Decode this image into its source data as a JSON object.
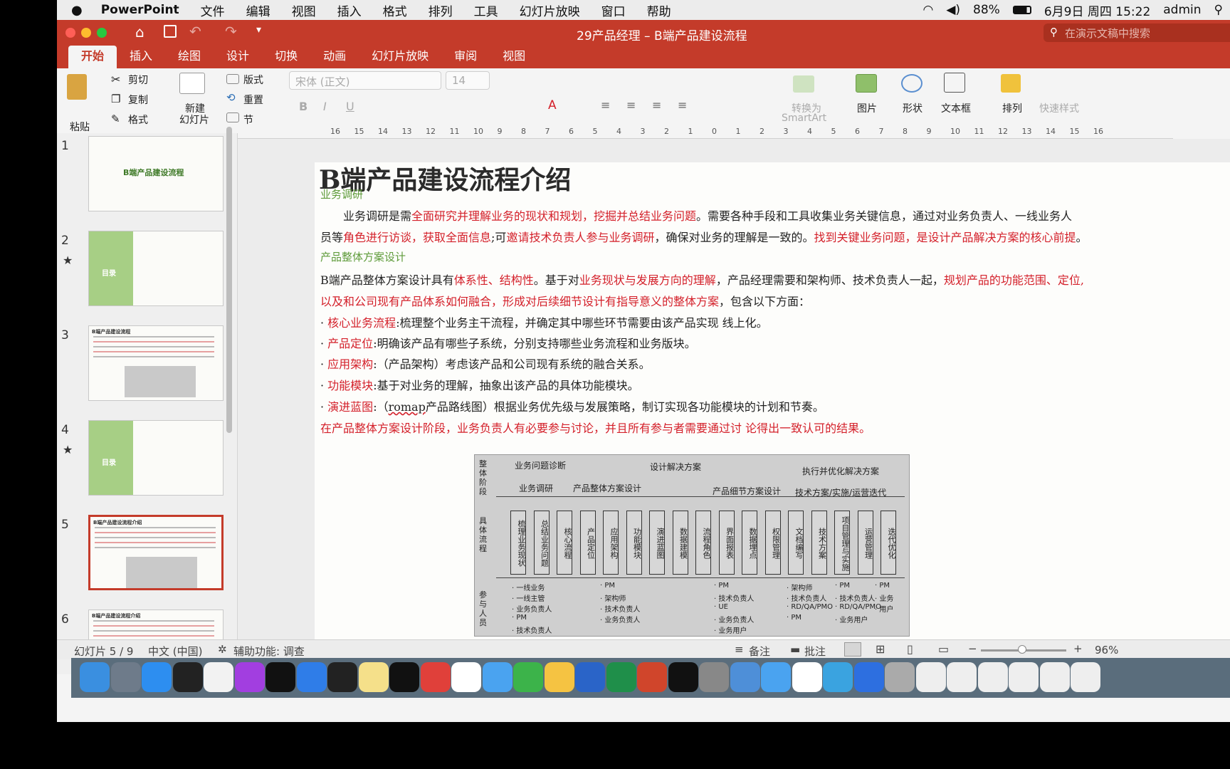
{
  "menubar": {
    "app_name": "PowerPoint",
    "items": [
      "文件",
      "编辑",
      "视图",
      "插入",
      "格式",
      "排列",
      "工具",
      "幻灯片放映",
      "窗口",
      "帮助"
    ],
    "battery": "88%",
    "datetime": "6月9日 周四 15:22",
    "user": "admin"
  },
  "window": {
    "title": "29产品经理 – B端产品建设流程",
    "search_placeholder": "在演示文稿中搜索"
  },
  "tabs": [
    "开始",
    "插入",
    "绘图",
    "设计",
    "切换",
    "动画",
    "幻灯片放映",
    "审阅",
    "视图"
  ],
  "ribbon": {
    "paste": "粘贴",
    "cut": "剪切",
    "copy": "复制",
    "format": "格式",
    "new_slide_line1": "新建",
    "new_slide_line2": "幻灯片",
    "layout": "版式",
    "reset": "重置",
    "section": "节",
    "font_name": "宋体 (正文)",
    "font_size": "14",
    "convert_smartart_line1": "转换为",
    "convert_smartart_line2": "SmartArt",
    "picture": "图片",
    "shape": "形状",
    "textbox": "文本框",
    "arrange": "排列",
    "quick_styles": "快速样式"
  },
  "thumbnails": [
    {
      "number": "1",
      "title": "B端产品建设流程",
      "starred": false
    },
    {
      "number": "2",
      "title": "目录",
      "starred": true
    },
    {
      "number": "3",
      "title": "B端产品建设流程",
      "starred": false
    },
    {
      "number": "4",
      "title": "目录",
      "starred": true
    },
    {
      "number": "5",
      "title": "B端产品建设流程介绍",
      "starred": false,
      "selected": true
    },
    {
      "number": "6",
      "title": "B端产品建设流程介绍",
      "starred": false
    }
  ],
  "ruler_labels": [
    "16",
    "15",
    "14",
    "13",
    "12",
    "11",
    "10",
    "9",
    "8",
    "7",
    "6",
    "5",
    "4",
    "3",
    "2",
    "1",
    "0",
    "1",
    "2",
    "3",
    "4",
    "5",
    "6",
    "7",
    "8",
    "9",
    "10",
    "11",
    "12",
    "13",
    "14",
    "15",
    "16"
  ],
  "slide": {
    "title": "B端产品建设流程介绍",
    "section1": "业务调研",
    "p1a": "业务调研是需",
    "p1b": "全面研究并理解业务的现状和规划，挖掘并总结业务问题",
    "p1c": "。需要各种手段和工具收集业务关键信息，通过对业务负责人、一线业务人",
    "p2a": "员等",
    "p2b": "角色进行访谈，获取全面信息",
    "p2c": ";可",
    "p2d": "邀请技术负责人参与业务调研",
    "p2e": "，确保对业务的理解是一致的。",
    "p2f": "找到关键业务问题，是设计产品解决方案的核心前提",
    "p2g": "。",
    "section2": "产品整体方案设计",
    "p3a": "B端产品整体方案设计具有",
    "p3b": "体系性、结构性",
    "p3c": "。基于对",
    "p3d": "业务现状与发展方向的理解",
    "p3e": "，产品经理需要和架构师、技术负责人一起，",
    "p3f": "规划产品的功能范围、定位,",
    "p4a": "以及和公司现有产品体系如何融合，形成对后续细节设计有指导意义的整体方案",
    "p4b": "，包含以下方面：",
    "b1a": "核心业务流程",
    "b1b": ":梳理整个业务主干流程，并确定其中哪些环节需要由该产品实现 线上化。",
    "b2a": "产品定位",
    "b2b": ":明确该产品有哪些子系统，分别支持哪些业务流程和业务版块。",
    "b3a": "应用架构",
    "b3b": ":（产品架构）考虑该产品和公司现有系统的融合关系。",
    "b4a": "功能模块",
    "b4b": ":基于对业务的理解，抽象出该产品的具体功能模块。",
    "b5a": "演进蓝图",
    "b5b": ":（",
    "b5c": "romap",
    "b5d": "产品路线图）根据业务优先级与发展策略，制订实现各功能模块的计划和节奏。",
    "p5": "在产品整体方案设计阶段，业务负责人有必要参与讨论，并且所有参与者需要通过讨 论得出一致认可的结果。"
  },
  "diagram": {
    "row_label_stage": "整体阶段",
    "row_label_flow": "具体流程",
    "row_label_people": "参与人员",
    "stage_headers": [
      "业务问题诊断",
      "设计解决方案",
      "执行并优化解决方案"
    ],
    "sub_headers": [
      "业务调研",
      "产品整体方案设计",
      "产品细节方案设计",
      "技术方案/实施/运营迭代"
    ],
    "columns": [
      "梳理业务现状",
      "总结业务问题",
      "核心流程",
      "产品定位",
      "应用架构",
      "功能模块",
      "演进蓝图",
      "数据建模",
      "流程角色",
      "界面报表",
      "数据埋点",
      "权限管理",
      "文档编写",
      "技术方案",
      "项目管理与实施",
      "运营管理",
      "迭代优化"
    ],
    "people": [
      "· 一线业务",
      "· 一线主管",
      "· 业务负责人",
      "· PM",
      "· 技术负责人",
      "· PM",
      "· 架构师",
      "· 技术负责人",
      "· 业务负责人",
      "· PM",
      "· 技术负责人",
      "· UE",
      "· 业务负责人",
      "· 业务用户",
      "· 架构师",
      "· 技术负责人",
      "· RD/QA/PMO",
      "· PM",
      "· PM",
      "· 技术负责人",
      "· RD/QA/PMO",
      "· 业务用户",
      "· PM",
      "· 业务",
      "· 用户"
    ]
  },
  "status": {
    "slide_info": "幻灯片 5 / 9",
    "language": "中文 (中国)",
    "accessibility": "辅助功能: 调查",
    "notes": "备注",
    "comments": "批注",
    "zoom": "96%"
  },
  "colors": {
    "accent": "#c43b2a",
    "red_text": "#d4202a",
    "green_text": "#5e9b3a"
  }
}
